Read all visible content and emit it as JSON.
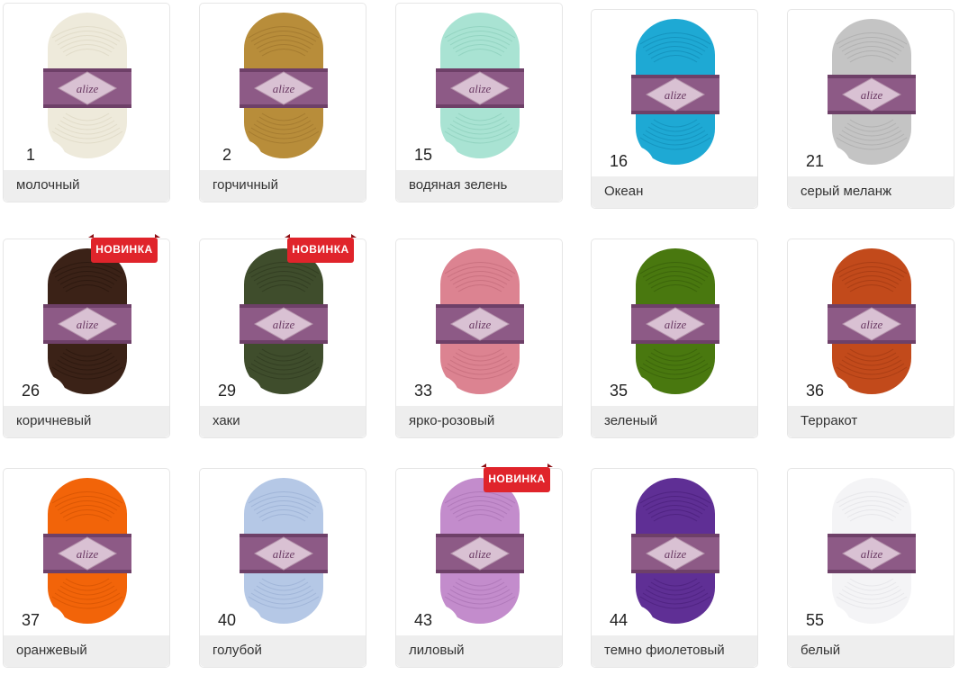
{
  "logo_text": "alize",
  "badge_label": "НОВИНКА",
  "yarns": [
    {
      "number": "1",
      "name": "молочный",
      "color": "#eeeadb",
      "shade": "#d8d2bd",
      "new": false
    },
    {
      "number": "2",
      "name": "горчичный",
      "color": "#b88d3a",
      "shade": "#98702a",
      "new": false
    },
    {
      "number": "15",
      "name": "водяная зелень",
      "color": "#a9e3d3",
      "shade": "#86c9b6",
      "new": false
    },
    {
      "number": "16",
      "name": "Океан",
      "color": "#1ea9d4",
      "shade": "#0f87b1",
      "new": false
    },
    {
      "number": "21",
      "name": "серый меланж",
      "color": "#c4c4c4",
      "shade": "#a5a5a5",
      "new": false
    },
    {
      "number": "26",
      "name": "коричневый",
      "color": "#3b2217",
      "shade": "#24140c",
      "new": true
    },
    {
      "number": "29",
      "name": "хаки",
      "color": "#3f4d2c",
      "shade": "#2b361c",
      "new": true
    },
    {
      "number": "33",
      "name": "ярко-розовый",
      "color": "#dc8391",
      "shade": "#be6675",
      "new": false
    },
    {
      "number": "35",
      "name": "зеленый",
      "color": "#49780f",
      "shade": "#345808",
      "new": false
    },
    {
      "number": "36",
      "name": "Терракот",
      "color": "#c24a1b",
      "shade": "#9a3510",
      "new": false
    },
    {
      "number": "37",
      "name": "оранжевый",
      "color": "#f26409",
      "shade": "#cc4f02",
      "new": false
    },
    {
      "number": "40",
      "name": "голубой",
      "color": "#b5c8e6",
      "shade": "#93a9cf",
      "new": false
    },
    {
      "number": "43",
      "name": "лиловый",
      "color": "#c38ccc",
      "shade": "#a36cae",
      "new": true
    },
    {
      "number": "44",
      "name": "темно фиолетовый",
      "color": "#5f2f95",
      "shade": "#461d76",
      "new": false
    },
    {
      "number": "55",
      "name": "белый",
      "color": "#f4f4f6",
      "shade": "#dedee2",
      "new": false
    }
  ]
}
